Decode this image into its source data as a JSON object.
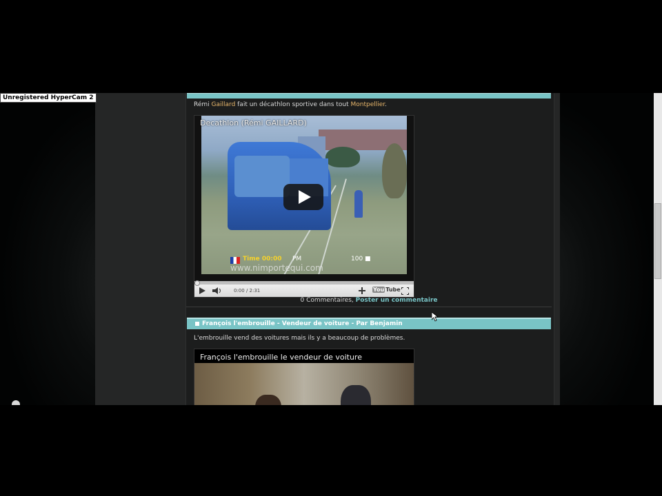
{
  "recorder": {
    "watermark": "Unregistered HyperCam 2"
  },
  "posts": [
    {
      "title": "",
      "description_parts": [
        {
          "text": "Rémi ",
          "highlight": false
        },
        {
          "text": "Gaillard",
          "highlight": true
        },
        {
          "text": " fait un décathlon sportive dans tout ",
          "highlight": false
        },
        {
          "text": "Montpellier",
          "highlight": true
        },
        {
          "text": ".",
          "highlight": false
        }
      ],
      "video": {
        "title": "Decathlon (Rémi GAILLARD)",
        "overlay_date": "Time 00:00",
        "overlay_pm": "PM",
        "overlay_kmh": "100 ■",
        "overlay_site": "www.nimportequi.com",
        "time": "0:00 / 2:31",
        "progress_fraction": 0.0,
        "youtube_label": "You",
        "youtube_tube": "Tube"
      },
      "footer": {
        "comments": "0 Commentaires, ",
        "post_comment": "Poster un commentaire"
      }
    },
    {
      "title": "François l'embrouille - Vendeur de voiture - Par Benjamin",
      "description": "L'embrouille vend des voitures mais ils y a beaucoup de problèmes.",
      "video": {
        "title": "François l'embrouille le vendeur de voiture"
      }
    }
  ],
  "colors": {
    "title_bar": "#79c4c6",
    "link": "#79c4c6",
    "highlight": "#e7b66b",
    "page_bg": "#1c1d1d"
  },
  "icons": [
    "play-icon",
    "volume-icon",
    "plus-icon",
    "fullscreen-icon",
    "flag-icon",
    "mouse-cursor-icon"
  ]
}
